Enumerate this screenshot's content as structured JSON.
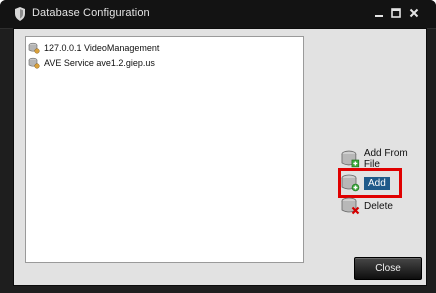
{
  "window": {
    "title": "Database Configuration",
    "minimize_glyph": "‒",
    "maximize_glyph": "□",
    "close_glyph": "x"
  },
  "databases": [
    {
      "name": "127.0.0.1 VideoManagement",
      "icon": "database-icon"
    },
    {
      "name": "AVE Service ave1.2.giep.us",
      "icon": "database-icon"
    }
  ],
  "actions": {
    "add_from_file": "Add From File",
    "add": "Add",
    "delete": "Delete"
  },
  "footer": {
    "close_label": "Close"
  },
  "colors": {
    "titlebar": "#131313",
    "window_frame": "#1e1e1e",
    "panel": "#e2e2e2",
    "highlight": "#e00000",
    "selected_action_bg": "#1f5a8a"
  }
}
